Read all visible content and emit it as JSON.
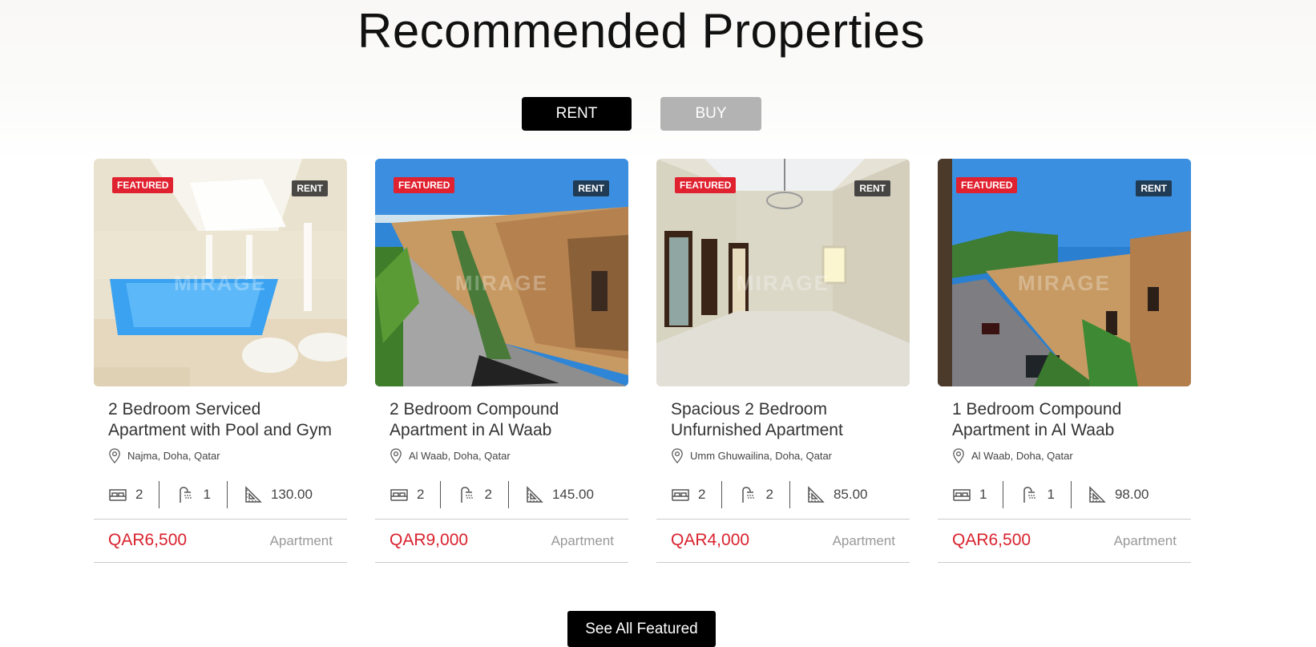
{
  "section": {
    "title": "Recommended Properties"
  },
  "tabs": {
    "rent_label": "RENT",
    "buy_label": "BUY"
  },
  "brand": {
    "watermark": "MIRAGE"
  },
  "cards": [
    {
      "featured": "FEATURED",
      "listing_type": "RENT",
      "title": "2 Bedroom Serviced Apartment with Pool and Gym",
      "location": "Najma, Doha, Qatar",
      "beds": "2",
      "baths": "1",
      "area": "130.00",
      "price": "QAR6,500",
      "type": "Apartment"
    },
    {
      "featured": "FEATURED",
      "listing_type": "RENT",
      "title": "2 Bedroom Compound Apartment in Al Waab",
      "location": "Al Waab, Doha, Qatar",
      "beds": "2",
      "baths": "2",
      "area": "145.00",
      "price": "QAR9,000",
      "type": "Apartment"
    },
    {
      "featured": "FEATURED",
      "listing_type": "RENT",
      "title": "Spacious 2 Bedroom Unfurnished Apartment",
      "location": "Umm Ghuwailina, Doha, Qatar",
      "beds": "2",
      "baths": "2",
      "area": "85.00",
      "price": "QAR4,000",
      "type": "Apartment"
    },
    {
      "featured": "FEATURED",
      "listing_type": "RENT",
      "title": "1 Bedroom Compound Apartment in Al Waab",
      "location": "Al Waab, Doha, Qatar",
      "beds": "1",
      "baths": "1",
      "area": "98.00",
      "price": "QAR6,500",
      "type": "Apartment"
    }
  ],
  "cta": {
    "see_all_label": "See All Featured"
  },
  "colors": {
    "accent_red": "#d9222e",
    "featured_badge": "#e0212f",
    "rent_tab": "#000000",
    "buy_tab": "#b3b3b3"
  },
  "icons": {
    "location": "map-pin-icon",
    "beds": "bed-icon",
    "baths": "shower-icon",
    "area": "area-ruler-icon"
  }
}
